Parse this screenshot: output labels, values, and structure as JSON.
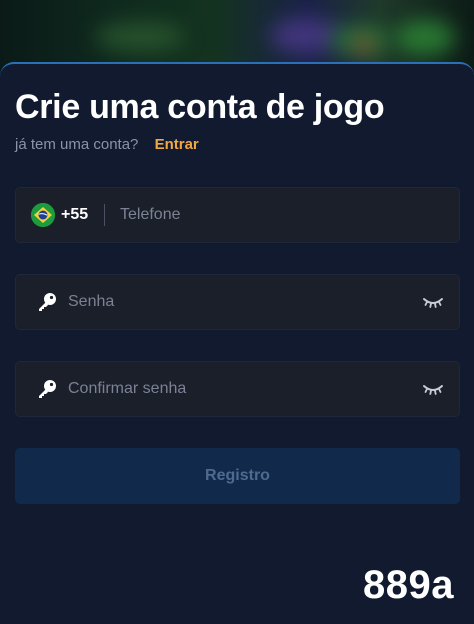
{
  "form": {
    "title": "Crie uma conta de jogo",
    "login_prompt": "já tem uma conta?",
    "login_link": "Entrar"
  },
  "phone": {
    "country_code": "+55",
    "placeholder": "Telefone",
    "flag_icon": "brazil-flag-icon"
  },
  "password": {
    "placeholder": "Senha",
    "icon": "key-icon",
    "toggle_icon": "eye-closed-icon"
  },
  "confirm_password": {
    "placeholder": "Confirmar senha",
    "icon": "key-icon",
    "toggle_icon": "eye-closed-icon"
  },
  "submit": {
    "label": "Registro"
  },
  "watermark": {
    "text": "889a"
  },
  "colors": {
    "accent_link": "#f0a845",
    "card_bg": "#121a30",
    "field_bg": "#1b1f2a",
    "button_bg": "#112a4b",
    "button_text": "#4d6a8f"
  }
}
